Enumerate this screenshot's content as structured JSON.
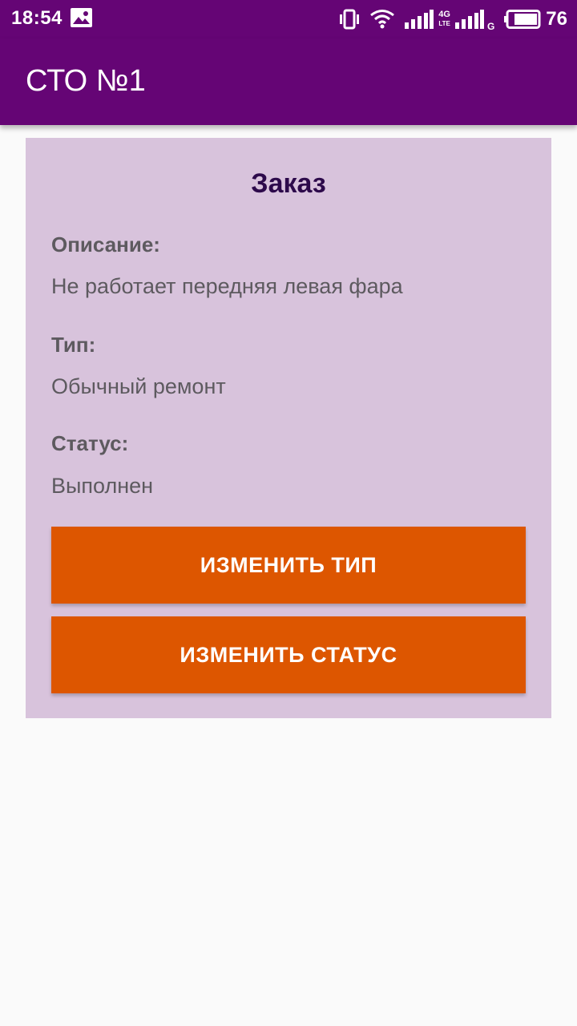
{
  "status_bar": {
    "time": "18:54",
    "battery": "76",
    "network_4g": "4G",
    "network_lte": "LTE",
    "network_g": "G"
  },
  "app_bar": {
    "title": "СТО №1"
  },
  "order": {
    "title": "Заказ",
    "description_label": "Описание:",
    "description_value": "Не работает передняя левая фара",
    "type_label": "Тип:",
    "type_value": "Обычный ремонт",
    "status_label": "Статус:",
    "status_value": "Выполнен"
  },
  "buttons": {
    "change_type": "ИЗМЕНИТЬ ТИП",
    "change_status": "ИЗМЕНИТЬ СТАТУС"
  },
  "colors": {
    "primary": "#650575",
    "card_background": "#d8c3dc",
    "accent_button": "#dd5600",
    "title_text": "#2d0a4b",
    "body_text": "#5d5a5f",
    "page_background": "#fafafa"
  },
  "icons": [
    "image-notification-icon",
    "vibrate-icon",
    "wifi-icon",
    "signal-icon",
    "battery-icon"
  ]
}
